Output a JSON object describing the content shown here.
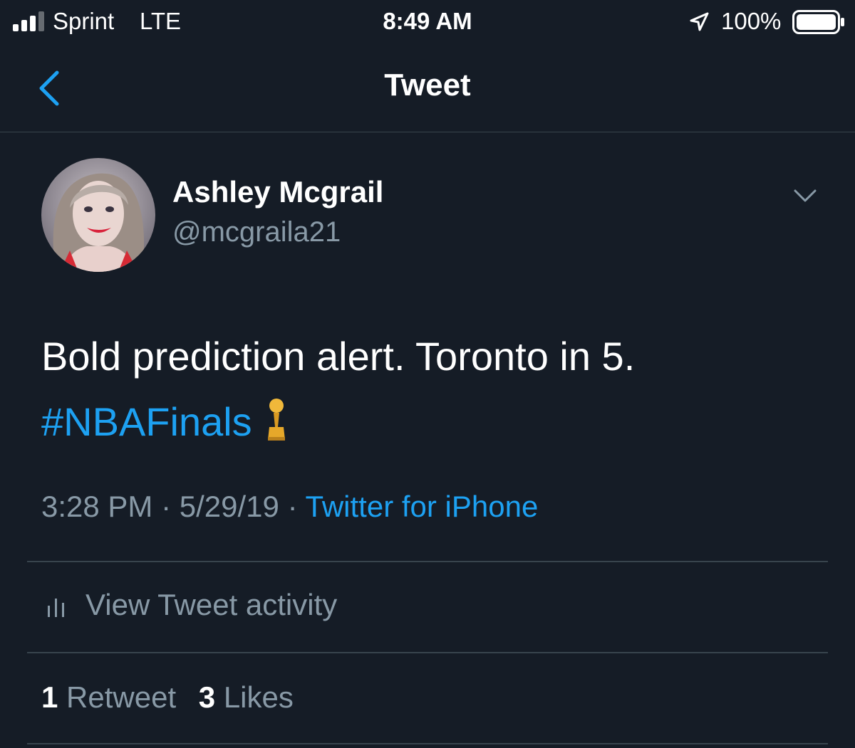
{
  "status_bar": {
    "carrier": "Sprint",
    "network": "LTE",
    "time": "8:49 AM",
    "battery_percent": "100%",
    "signal_bars": 3,
    "signal_bars_total": 4,
    "icons": [
      "signal-icon",
      "location-arrow-icon",
      "battery-icon"
    ]
  },
  "nav": {
    "title": "Tweet",
    "back_icon": "chevron-left-icon"
  },
  "tweet": {
    "author_name": "Ashley Mcgrail",
    "author_handle": "@mcgraila21",
    "text": "Bold prediction alert. Toronto in 5.",
    "hashtag": "#NBAFinals",
    "emoji": "trophy-icon",
    "time": "3:28 PM",
    "separator": "·",
    "date": "5/29/19",
    "source": "Twitter for iPhone",
    "activity_label": "View Tweet activity",
    "retweet_count": "1",
    "retweet_label": "Retweet",
    "like_count": "3",
    "like_label": "Likes"
  },
  "colors": {
    "background": "#151c26",
    "accent": "#1da1f2",
    "secondary_text": "#8899a6",
    "divider": "#38444d"
  }
}
